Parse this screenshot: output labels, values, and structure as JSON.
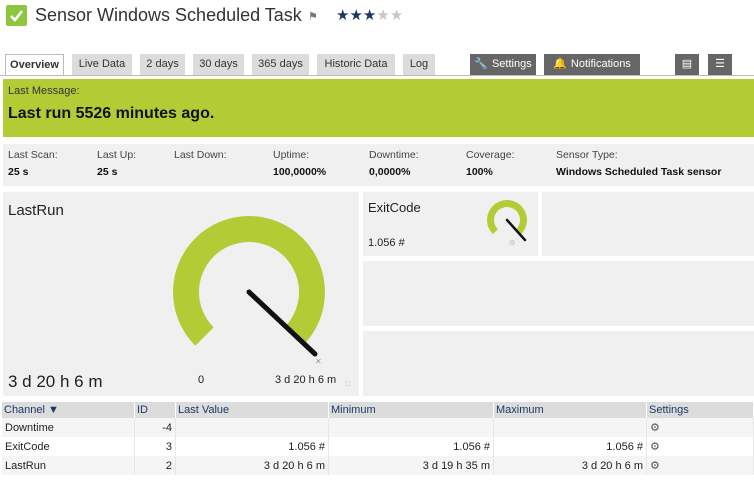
{
  "header": {
    "title": "Sensor Windows Scheduled Task",
    "priority_stars": 3,
    "priority_max": 5,
    "accent": "#8dc63f"
  },
  "tabs": [
    {
      "label": "Overview",
      "active": true
    },
    {
      "label": "Live Data"
    },
    {
      "label": "2 days"
    },
    {
      "label": "30 days"
    },
    {
      "label": "365 days"
    },
    {
      "label": "Historic Data"
    },
    {
      "label": "Log"
    }
  ],
  "actions": {
    "settings": "Settings",
    "notifications": "Notifications"
  },
  "message": {
    "label": "Last Message:",
    "text": "Last run 5526 minutes ago.",
    "color": "#b3cc35"
  },
  "stats": [
    {
      "key": "Last Scan:",
      "value": "25 s"
    },
    {
      "key": "Last Up:",
      "value": "25 s"
    },
    {
      "key": "Last Down:",
      "value": ""
    },
    {
      "key": "Uptime:",
      "value": "100,0000%"
    },
    {
      "key": "Downtime:",
      "value": "0,0000%"
    },
    {
      "key": "Coverage:",
      "value": "100%"
    },
    {
      "key": "Sensor Type:",
      "value": "Windows Scheduled Task sensor"
    }
  ],
  "gauges": {
    "lastrun": {
      "name": "LastRun",
      "value": "3 d 20 h 6 m",
      "min_label": "0",
      "max_label": "3 d 20 h 6 m",
      "fraction": 1.0
    },
    "exitcode": {
      "name": "ExitCode",
      "value": "1.056 #",
      "fraction": 1.0
    }
  },
  "table": {
    "headers": {
      "channel": "Channel",
      "id": "ID",
      "last": "Last Value",
      "min": "Minimum",
      "max": "Maximum",
      "settings": "Settings"
    },
    "rows": [
      {
        "channel": "Downtime",
        "id": "-4",
        "last": "",
        "min": "",
        "max": ""
      },
      {
        "channel": "ExitCode",
        "id": "3",
        "last": "1.056 #",
        "min": "1.056 #",
        "max": "1.056 #"
      },
      {
        "channel": "LastRun",
        "id": "2",
        "last": "3 d 20 h 6 m",
        "min": "3 d 19 h 35 m",
        "max": "3 d 20 h 6 m"
      }
    ]
  }
}
